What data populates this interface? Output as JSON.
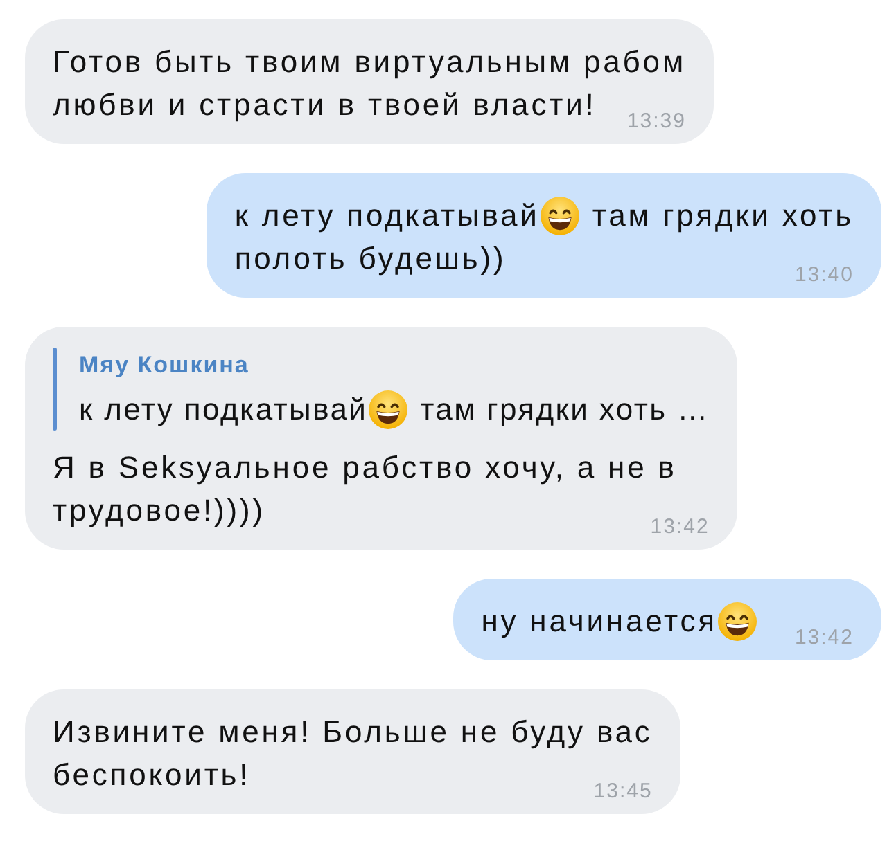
{
  "messages": [
    {
      "outgoing": false,
      "time": "13:39",
      "lines": [
        [
          {
            "kind": "text",
            "text": "Готов быть твоим виртуальным рабом"
          }
        ],
        [
          {
            "kind": "text",
            "text": "любви и страсти в твоей власти!"
          }
        ]
      ]
    },
    {
      "outgoing": true,
      "time": "13:40",
      "lines": [
        [
          {
            "kind": "text",
            "text": "к лету подкатывай"
          },
          {
            "kind": "emoji"
          },
          {
            "kind": "text",
            "text": "там грядки хоть"
          }
        ],
        [
          {
            "kind": "text",
            "text": "полоть будешь))"
          }
        ]
      ]
    },
    {
      "outgoing": false,
      "time": "13:42",
      "reply": {
        "name": "Мяу Кошкина",
        "parts": [
          {
            "kind": "text",
            "text": "к лету подкатывай"
          },
          {
            "kind": "emoji"
          },
          {
            "kind": "text",
            "text": "там грядки хоть …"
          }
        ]
      },
      "lines": [
        [
          {
            "kind": "text",
            "text": "Я в Seksуальное рабство хочу, а не в"
          }
        ],
        [
          {
            "kind": "text",
            "text": "трудовое!))))"
          }
        ]
      ]
    },
    {
      "outgoing": true,
      "time": "13:42",
      "lines": [
        [
          {
            "kind": "text",
            "text": "ну начинается"
          },
          {
            "kind": "emoji"
          }
        ]
      ]
    },
    {
      "outgoing": false,
      "time": "13:45",
      "lines": [
        [
          {
            "kind": "text",
            "text": "Извините меня! Больше не буду вас"
          }
        ],
        [
          {
            "kind": "text",
            "text": "беспокоить!"
          }
        ]
      ]
    }
  ]
}
